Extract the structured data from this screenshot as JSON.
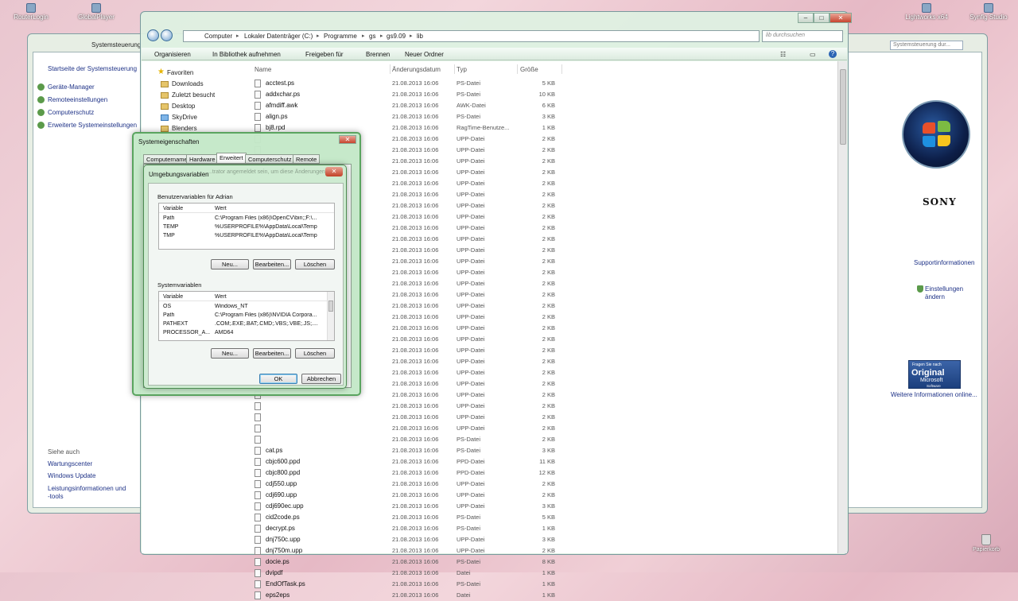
{
  "desktop": {
    "icons": [
      {
        "label": "RouterLogin",
        "name": "desktop-icon-routerlogin"
      },
      {
        "label": "GlobalPlayer",
        "name": "desktop-icon-globalplayer"
      },
      {
        "label": "Lightworks x64",
        "name": "desktop-icon-lightworks"
      },
      {
        "label": "Synfig Studio",
        "name": "desktop-icon-synfig"
      }
    ],
    "recycle_bin": "Papierkorb"
  },
  "control_panel": {
    "address_text": "Systemsteuerung",
    "search_placeholder": "Systemsteuerung dur...",
    "left_links": [
      "Startseite der Systemsteuerung",
      "Geräte-Manager",
      "Remoteeinstellungen",
      "Computerschutz",
      "Erweiterte Systemeinstellungen"
    ],
    "see_also_heading": "Siehe auch",
    "see_also_links": [
      "Wartungscenter",
      "Windows Update",
      "Leistungsinformationen und",
      "-tools"
    ],
    "oem_brand": "SONY",
    "support_link": "Supportinformationen",
    "change_settings": [
      "Einstellungen",
      "ändern"
    ],
    "genuine": {
      "line1": "Fragen Sie nach",
      "line2": "Original",
      "line3": "Microsoft",
      "line4": "Software"
    },
    "more_info_link": "Weitere Informationen online..."
  },
  "explorer": {
    "breadcrumb": [
      "Computer",
      "Lokaler Datenträger (C:)",
      "Programme",
      "gs",
      "gs9.09",
      "lib"
    ],
    "search_placeholder": "lib durchsuchen",
    "toolbar": [
      "Organisieren",
      "In Bibliothek aufnehmen",
      "Freigeben für",
      "Brennen",
      "Neuer Ordner"
    ],
    "tree": {
      "favorites": "Favoriten",
      "items": [
        "Downloads",
        "Zuletzt besucht",
        "Desktop",
        "SkyDrive",
        "Blenders"
      ]
    },
    "columns": {
      "name": "Name",
      "date": "Änderungsdatum",
      "type": "Typ",
      "size": "Größe"
    },
    "files": [
      {
        "name": "acctest.ps",
        "date": "21.08.2013 16:06",
        "type": "PS-Datei",
        "size": "5 KB"
      },
      {
        "name": "addxchar.ps",
        "date": "21.08.2013 16:06",
        "type": "PS-Datei",
        "size": "10 KB"
      },
      {
        "name": "afmdiff.awk",
        "date": "21.08.2013 16:06",
        "type": "AWK-Datei",
        "size": "6 KB"
      },
      {
        "name": "align.ps",
        "date": "21.08.2013 16:06",
        "type": "PS-Datei",
        "size": "3 KB"
      },
      {
        "name": "bj8.rpd",
        "date": "21.08.2013 16:06",
        "type": "RagTime-Benutze...",
        "size": "1 KB"
      },
      {
        "name": "",
        "date": "21.08.2013 16:06",
        "type": "UPP-Datei",
        "size": "2 KB"
      },
      {
        "name": "",
        "date": "21.08.2013 16:06",
        "type": "UPP-Datei",
        "size": "2 KB"
      },
      {
        "name": "",
        "date": "21.08.2013 16:06",
        "type": "UPP-Datei",
        "size": "2 KB"
      },
      {
        "name": "",
        "date": "21.08.2013 16:06",
        "type": "UPP-Datei",
        "size": "2 KB"
      },
      {
        "name": "",
        "date": "21.08.2013 16:06",
        "type": "UPP-Datei",
        "size": "2 KB"
      },
      {
        "name": "",
        "date": "21.08.2013 16:06",
        "type": "UPP-Datei",
        "size": "2 KB"
      },
      {
        "name": "",
        "date": "21.08.2013 16:06",
        "type": "UPP-Datei",
        "size": "2 KB"
      },
      {
        "name": "",
        "date": "21.08.2013 16:06",
        "type": "UPP-Datei",
        "size": "2 KB"
      },
      {
        "name": "",
        "date": "21.08.2013 16:06",
        "type": "UPP-Datei",
        "size": "2 KB"
      },
      {
        "name": "",
        "date": "21.08.2013 16:06",
        "type": "UPP-Datei",
        "size": "2 KB"
      },
      {
        "name": "",
        "date": "21.08.2013 16:06",
        "type": "UPP-Datei",
        "size": "2 KB"
      },
      {
        "name": "",
        "date": "21.08.2013 16:06",
        "type": "UPP-Datei",
        "size": "2 KB"
      },
      {
        "name": "",
        "date": "21.08.2013 16:06",
        "type": "UPP-Datei",
        "size": "2 KB"
      },
      {
        "name": "",
        "date": "21.08.2013 16:06",
        "type": "UPP-Datei",
        "size": "2 KB"
      },
      {
        "name": "",
        "date": "21.08.2013 16:06",
        "type": "UPP-Datei",
        "size": "2 KB"
      },
      {
        "name": "",
        "date": "21.08.2013 16:06",
        "type": "UPP-Datei",
        "size": "2 KB"
      },
      {
        "name": "",
        "date": "21.08.2013 16:06",
        "type": "UPP-Datei",
        "size": "2 KB"
      },
      {
        "name": "",
        "date": "21.08.2013 16:06",
        "type": "UPP-Datei",
        "size": "2 KB"
      },
      {
        "name": "",
        "date": "21.08.2013 16:06",
        "type": "UPP-Datei",
        "size": "2 KB"
      },
      {
        "name": "",
        "date": "21.08.2013 16:06",
        "type": "UPP-Datei",
        "size": "2 KB"
      },
      {
        "name": "",
        "date": "21.08.2013 16:06",
        "type": "UPP-Datei",
        "size": "2 KB"
      },
      {
        "name": "",
        "date": "21.08.2013 16:06",
        "type": "UPP-Datei",
        "size": "2 KB"
      },
      {
        "name": "",
        "date": "21.08.2013 16:06",
        "type": "UPP-Datei",
        "size": "2 KB"
      },
      {
        "name": "",
        "date": "21.08.2013 16:06",
        "type": "UPP-Datei",
        "size": "2 KB"
      },
      {
        "name": "",
        "date": "21.08.2013 16:06",
        "type": "UPP-Datei",
        "size": "2 KB"
      },
      {
        "name": "",
        "date": "21.08.2013 16:06",
        "type": "UPP-Datei",
        "size": "2 KB"
      },
      {
        "name": "",
        "date": "21.08.2013 16:06",
        "type": "UPP-Datei",
        "size": "2 KB"
      },
      {
        "name": "",
        "date": "21.08.2013 16:06",
        "type": "PS-Datei",
        "size": "2 KB"
      },
      {
        "name": "cat.ps",
        "date": "21.08.2013 16:06",
        "type": "PS-Datei",
        "size": "3 KB"
      },
      {
        "name": "cbjc600.ppd",
        "date": "21.08.2013 16:06",
        "type": "PPD-Datei",
        "size": "11 KB"
      },
      {
        "name": "cbjc800.ppd",
        "date": "21.08.2013 16:06",
        "type": "PPD-Datei",
        "size": "12 KB"
      },
      {
        "name": "cdj550.upp",
        "date": "21.08.2013 16:06",
        "type": "UPP-Datei",
        "size": "2 KB"
      },
      {
        "name": "cdj690.upp",
        "date": "21.08.2013 16:06",
        "type": "UPP-Datei",
        "size": "2 KB"
      },
      {
        "name": "cdj690ec.upp",
        "date": "21.08.2013 16:06",
        "type": "UPP-Datei",
        "size": "3 KB"
      },
      {
        "name": "cid2code.ps",
        "date": "21.08.2013 16:06",
        "type": "PS-Datei",
        "size": "5 KB"
      },
      {
        "name": "decrypt.ps",
        "date": "21.08.2013 16:06",
        "type": "PS-Datei",
        "size": "1 KB"
      },
      {
        "name": "dnj750c.upp",
        "date": "21.08.2013 16:06",
        "type": "UPP-Datei",
        "size": "3 KB"
      },
      {
        "name": "dnj750m.upp",
        "date": "21.08.2013 16:06",
        "type": "UPP-Datei",
        "size": "2 KB"
      },
      {
        "name": "docie.ps",
        "date": "21.08.2013 16:06",
        "type": "PS-Datei",
        "size": "8 KB"
      },
      {
        "name": "dvipdf",
        "date": "21.08.2013 16:06",
        "type": "Datei",
        "size": "1 KB"
      },
      {
        "name": "EndOfTask.ps",
        "date": "21.08.2013 16:06",
        "type": "PS-Datei",
        "size": "1 KB"
      },
      {
        "name": "eps2eps",
        "date": "21.08.2013 16:06",
        "type": "Datei",
        "size": "1 KB"
      }
    ]
  },
  "system_properties": {
    "title": "Systemeigenschaften",
    "tabs": [
      "Computername",
      "Hardware",
      "Erweitert",
      "Computerschutz",
      "Remote"
    ],
    "active_tab": "Erweitert"
  },
  "env_vars": {
    "title": "Umgebungsvariablen",
    "ghost_text": "...trator angemeldet sein, um diese Änderungen",
    "close_label": "✕",
    "user_group": "Benutzervariablen für Adrian",
    "system_group": "Systemvariablen",
    "col_variable": "Variable",
    "col_value": "Wert",
    "user_vars": [
      {
        "name": "Path",
        "value": "C:\\Program Files (x86)\\OpenCV\\bin;;F:\\..."
      },
      {
        "name": "TEMP",
        "value": "%USERPROFILE%\\AppData\\Local\\Temp"
      },
      {
        "name": "TMP",
        "value": "%USERPROFILE%\\AppData\\Local\\Temp"
      }
    ],
    "system_vars": [
      {
        "name": "OS",
        "value": "Windows_NT"
      },
      {
        "name": "Path",
        "value": "C:\\Program Files (x86)\\NVIDIA Corpora..."
      },
      {
        "name": "PATHEXT",
        "value": ".COM;.EXE;.BAT;.CMD;.VBS;.VBE;.JS;...."
      },
      {
        "name": "PROCESSOR_A...",
        "value": "AMD64"
      }
    ],
    "btn_new": "Neu...",
    "btn_edit": "Bearbeiten...",
    "btn_delete": "Löschen",
    "btn_ok": "OK",
    "btn_cancel": "Abbrechen"
  }
}
